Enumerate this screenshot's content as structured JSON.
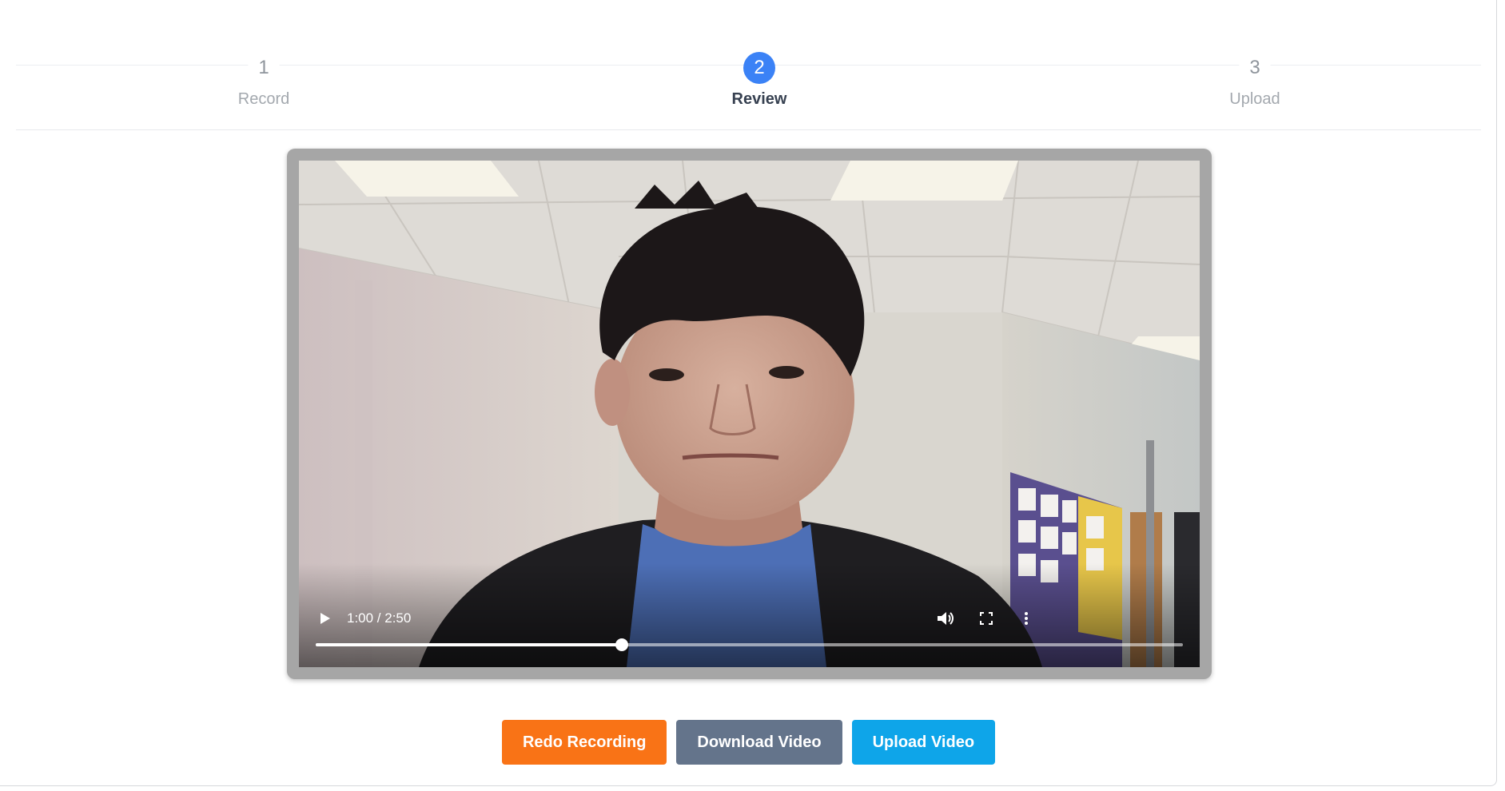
{
  "stepper": {
    "steps": [
      {
        "number": "1",
        "label": "Record",
        "state": "inactive"
      },
      {
        "number": "2",
        "label": "Review",
        "state": "active"
      },
      {
        "number": "3",
        "label": "Upload",
        "state": "inactive"
      }
    ],
    "active_color": "#3b82f6"
  },
  "video_player": {
    "current_time": "1:00",
    "duration": "2:50",
    "time_display": "1:00 / 2:50",
    "progress_fraction": 0.353,
    "icons": {
      "play": "play-icon",
      "volume": "volume-icon",
      "fullscreen": "fullscreen-icon",
      "more": "more-options-icon"
    }
  },
  "actions": {
    "redo_label": "Redo Recording",
    "download_label": "Download Video",
    "upload_label": "Upload Video",
    "colors": {
      "redo": "#f97316",
      "download": "#64748b",
      "upload": "#0ea5e9"
    }
  }
}
